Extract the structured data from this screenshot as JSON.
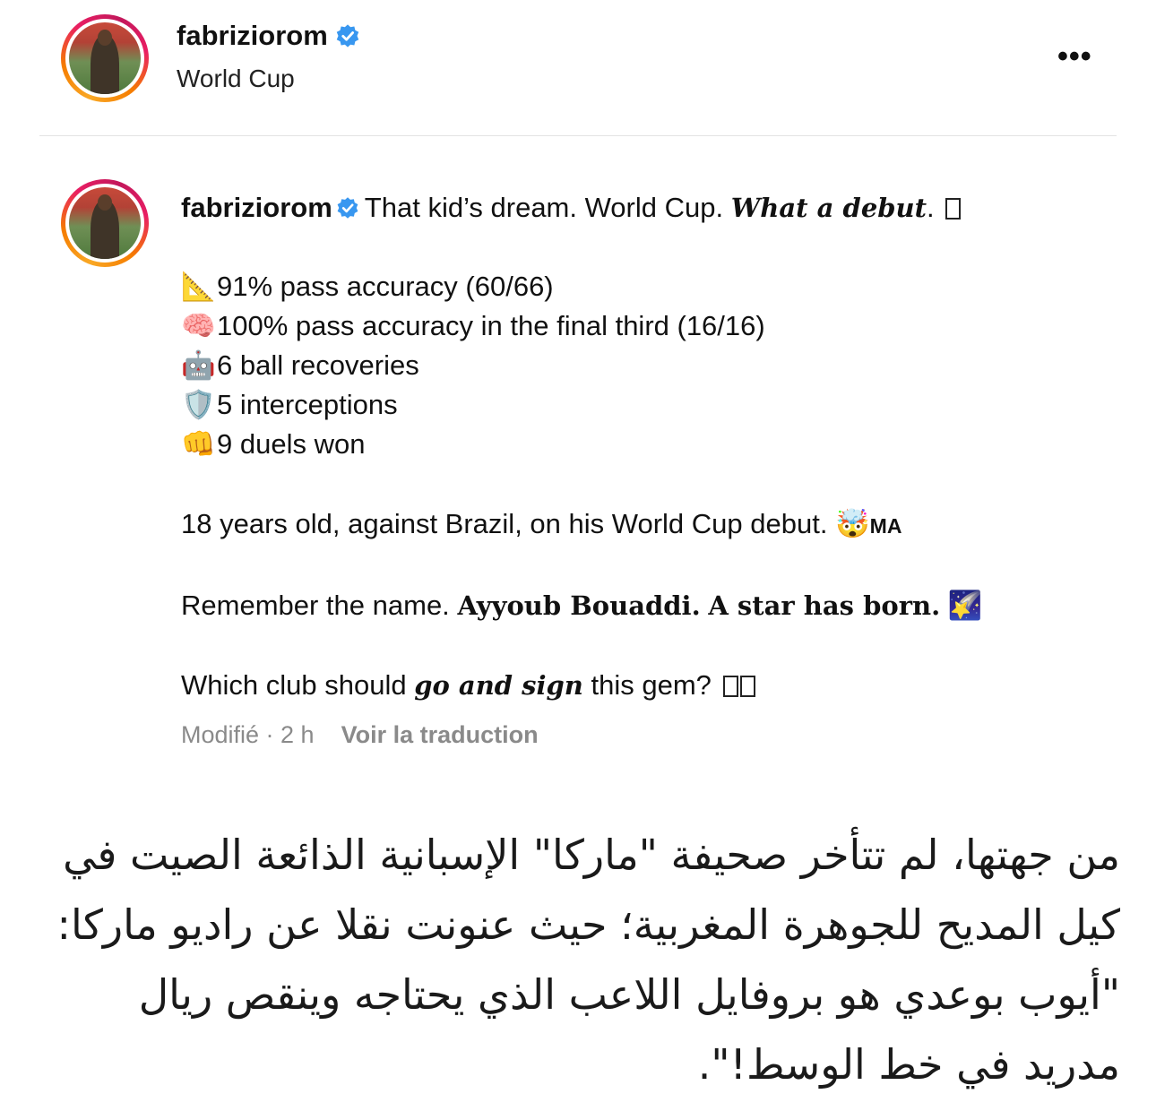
{
  "header": {
    "username": "fabriziorom",
    "subtitle": "World Cup",
    "more_icon": "more-horizontal-icon",
    "more_label": "•••"
  },
  "post": {
    "username": "fabriziorom",
    "intro": "That kid’s dream. World Cup.",
    "intro_bold": "What a debut",
    "intro_end": ".",
    "stats": [
      {
        "emoji": "📐",
        "icon": "triangular-ruler-icon",
        "text": "91% pass accuracy (60/66)"
      },
      {
        "emoji": "🧠",
        "icon": "brain-icon",
        "text": "100% pass accuracy in the final third (16/16)"
      },
      {
        "emoji": "🤖",
        "icon": "robot-icon",
        "text": "6 ball recoveries"
      },
      {
        "emoji": "🛡️",
        "icon": "shield-icon",
        "text": "5 interceptions"
      },
      {
        "emoji": "👊",
        "icon": "fist-icon",
        "text": "9 duels won"
      }
    ],
    "line_brazil": "18 years old, against Brazil, on his World Cup debut.",
    "line_brazil_emoji": "🤯",
    "line_brazil_suffix": "MA",
    "remember_prefix": "Remember the name.",
    "remember_name": "Ayyoub Bouaddi",
    "remember_mid": ".",
    "remember_star": "A star has born",
    "remember_end": ".",
    "remember_emoji": "🌠",
    "question_prefix": "Which club should",
    "question_bold": "go and sign",
    "question_suffix": "this gem?",
    "meta_edited": "Modifié · 2 h",
    "meta_translate": "Voir la traduction"
  },
  "article": {
    "text": "من جهتها، لم تتأخر صحيفة \"ماركا\" الإسبانية الذائعة الصيت في كيل المديح للجوهرة المغربية؛ حيث عنونت  نقلا عن راديو ماركا: \"أيوب بوعدي هو بروفايل اللاعب الذي يحتاجه وينقص ريال مدريد في خط الوسط!\"."
  }
}
